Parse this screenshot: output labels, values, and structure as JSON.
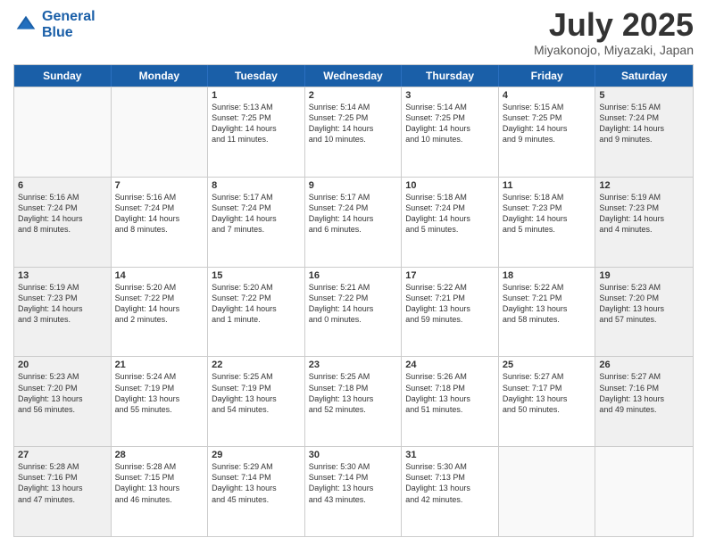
{
  "logo": {
    "line1": "General",
    "line2": "Blue"
  },
  "title": "July 2025",
  "location": "Miyakonojo, Miyazaki, Japan",
  "header_days": [
    "Sunday",
    "Monday",
    "Tuesday",
    "Wednesday",
    "Thursday",
    "Friday",
    "Saturday"
  ],
  "rows": [
    [
      {
        "day": "",
        "info": "",
        "shaded": true,
        "empty": true
      },
      {
        "day": "",
        "info": "",
        "shaded": true,
        "empty": true
      },
      {
        "day": "1",
        "info": "Sunrise: 5:13 AM\nSunset: 7:25 PM\nDaylight: 14 hours\nand 11 minutes.",
        "shaded": false
      },
      {
        "day": "2",
        "info": "Sunrise: 5:14 AM\nSunset: 7:25 PM\nDaylight: 14 hours\nand 10 minutes.",
        "shaded": false
      },
      {
        "day": "3",
        "info": "Sunrise: 5:14 AM\nSunset: 7:25 PM\nDaylight: 14 hours\nand 10 minutes.",
        "shaded": false
      },
      {
        "day": "4",
        "info": "Sunrise: 5:15 AM\nSunset: 7:25 PM\nDaylight: 14 hours\nand 9 minutes.",
        "shaded": false
      },
      {
        "day": "5",
        "info": "Sunrise: 5:15 AM\nSunset: 7:24 PM\nDaylight: 14 hours\nand 9 minutes.",
        "shaded": true
      }
    ],
    [
      {
        "day": "6",
        "info": "Sunrise: 5:16 AM\nSunset: 7:24 PM\nDaylight: 14 hours\nand 8 minutes.",
        "shaded": true
      },
      {
        "day": "7",
        "info": "Sunrise: 5:16 AM\nSunset: 7:24 PM\nDaylight: 14 hours\nand 8 minutes.",
        "shaded": false
      },
      {
        "day": "8",
        "info": "Sunrise: 5:17 AM\nSunset: 7:24 PM\nDaylight: 14 hours\nand 7 minutes.",
        "shaded": false
      },
      {
        "day": "9",
        "info": "Sunrise: 5:17 AM\nSunset: 7:24 PM\nDaylight: 14 hours\nand 6 minutes.",
        "shaded": false
      },
      {
        "day": "10",
        "info": "Sunrise: 5:18 AM\nSunset: 7:24 PM\nDaylight: 14 hours\nand 5 minutes.",
        "shaded": false
      },
      {
        "day": "11",
        "info": "Sunrise: 5:18 AM\nSunset: 7:23 PM\nDaylight: 14 hours\nand 5 minutes.",
        "shaded": false
      },
      {
        "day": "12",
        "info": "Sunrise: 5:19 AM\nSunset: 7:23 PM\nDaylight: 14 hours\nand 4 minutes.",
        "shaded": true
      }
    ],
    [
      {
        "day": "13",
        "info": "Sunrise: 5:19 AM\nSunset: 7:23 PM\nDaylight: 14 hours\nand 3 minutes.",
        "shaded": true
      },
      {
        "day": "14",
        "info": "Sunrise: 5:20 AM\nSunset: 7:22 PM\nDaylight: 14 hours\nand 2 minutes.",
        "shaded": false
      },
      {
        "day": "15",
        "info": "Sunrise: 5:20 AM\nSunset: 7:22 PM\nDaylight: 14 hours\nand 1 minute.",
        "shaded": false
      },
      {
        "day": "16",
        "info": "Sunrise: 5:21 AM\nSunset: 7:22 PM\nDaylight: 14 hours\nand 0 minutes.",
        "shaded": false
      },
      {
        "day": "17",
        "info": "Sunrise: 5:22 AM\nSunset: 7:21 PM\nDaylight: 13 hours\nand 59 minutes.",
        "shaded": false
      },
      {
        "day": "18",
        "info": "Sunrise: 5:22 AM\nSunset: 7:21 PM\nDaylight: 13 hours\nand 58 minutes.",
        "shaded": false
      },
      {
        "day": "19",
        "info": "Sunrise: 5:23 AM\nSunset: 7:20 PM\nDaylight: 13 hours\nand 57 minutes.",
        "shaded": true
      }
    ],
    [
      {
        "day": "20",
        "info": "Sunrise: 5:23 AM\nSunset: 7:20 PM\nDaylight: 13 hours\nand 56 minutes.",
        "shaded": true
      },
      {
        "day": "21",
        "info": "Sunrise: 5:24 AM\nSunset: 7:19 PM\nDaylight: 13 hours\nand 55 minutes.",
        "shaded": false
      },
      {
        "day": "22",
        "info": "Sunrise: 5:25 AM\nSunset: 7:19 PM\nDaylight: 13 hours\nand 54 minutes.",
        "shaded": false
      },
      {
        "day": "23",
        "info": "Sunrise: 5:25 AM\nSunset: 7:18 PM\nDaylight: 13 hours\nand 52 minutes.",
        "shaded": false
      },
      {
        "day": "24",
        "info": "Sunrise: 5:26 AM\nSunset: 7:18 PM\nDaylight: 13 hours\nand 51 minutes.",
        "shaded": false
      },
      {
        "day": "25",
        "info": "Sunrise: 5:27 AM\nSunset: 7:17 PM\nDaylight: 13 hours\nand 50 minutes.",
        "shaded": false
      },
      {
        "day": "26",
        "info": "Sunrise: 5:27 AM\nSunset: 7:16 PM\nDaylight: 13 hours\nand 49 minutes.",
        "shaded": true
      }
    ],
    [
      {
        "day": "27",
        "info": "Sunrise: 5:28 AM\nSunset: 7:16 PM\nDaylight: 13 hours\nand 47 minutes.",
        "shaded": true
      },
      {
        "day": "28",
        "info": "Sunrise: 5:28 AM\nSunset: 7:15 PM\nDaylight: 13 hours\nand 46 minutes.",
        "shaded": false
      },
      {
        "day": "29",
        "info": "Sunrise: 5:29 AM\nSunset: 7:14 PM\nDaylight: 13 hours\nand 45 minutes.",
        "shaded": false
      },
      {
        "day": "30",
        "info": "Sunrise: 5:30 AM\nSunset: 7:14 PM\nDaylight: 13 hours\nand 43 minutes.",
        "shaded": false
      },
      {
        "day": "31",
        "info": "Sunrise: 5:30 AM\nSunset: 7:13 PM\nDaylight: 13 hours\nand 42 minutes.",
        "shaded": false
      },
      {
        "day": "",
        "info": "",
        "shaded": true,
        "empty": true
      },
      {
        "day": "",
        "info": "",
        "shaded": true,
        "empty": true
      }
    ]
  ]
}
